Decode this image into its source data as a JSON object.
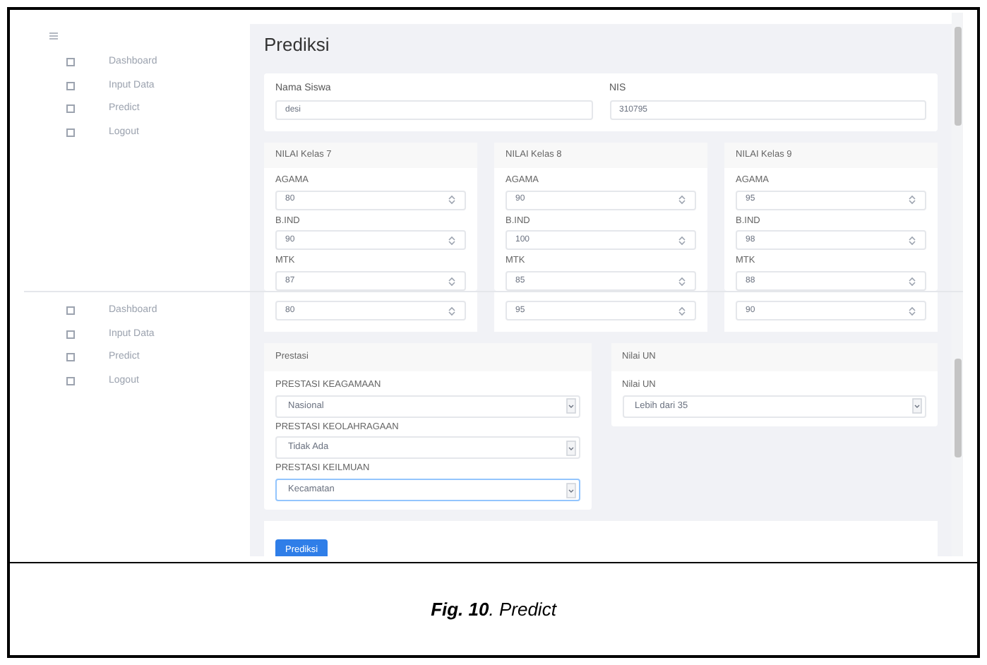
{
  "top_view": {
    "sidebar": [
      {
        "label": "Dashboard"
      },
      {
        "label": "Input Data"
      },
      {
        "label": "Predict"
      },
      {
        "label": "Logout"
      }
    ],
    "title": "Prediksi",
    "student": {
      "name_label": "Nama Siswa",
      "name_value": "desi",
      "nis_label": "NIS",
      "nis_value": "310795"
    },
    "grade_cards": [
      {
        "title": "NILAI Kelas 7",
        "fields": [
          {
            "label": "AGAMA",
            "value": "80"
          },
          {
            "label": "B.IND",
            "value": "90"
          },
          {
            "label": "MTK",
            "value": "87"
          }
        ]
      },
      {
        "title": "NILAI Kelas 8",
        "fields": [
          {
            "label": "AGAMA",
            "value": "90"
          },
          {
            "label": "B.IND",
            "value": "100"
          },
          {
            "label": "MTK",
            "value": "85"
          }
        ]
      },
      {
        "title": "NILAI Kelas 9",
        "fields": [
          {
            "label": "AGAMA",
            "value": "95"
          },
          {
            "label": "B.IND",
            "value": "98"
          },
          {
            "label": "MTK",
            "value": "88"
          }
        ]
      }
    ]
  },
  "bottom_view": {
    "sidebar": [
      {
        "label": "Dashboard"
      },
      {
        "label": "Input Data"
      },
      {
        "label": "Predict"
      },
      {
        "label": "Logout"
      }
    ],
    "grade_values": [
      "80",
      "95",
      "90"
    ],
    "prestasi": {
      "title": "Prestasi",
      "fields": [
        {
          "label": "PRESTASI KEAGAMAAN",
          "value": "Nasional",
          "focused": false
        },
        {
          "label": "PRESTASI KEOLAHRAGAAN",
          "value": "Tidak Ada",
          "focused": false
        },
        {
          "label": "PRESTASI KEILMUAN",
          "value": "Kecamatan",
          "focused": true
        }
      ]
    },
    "nilai_un": {
      "title": "Nilai UN",
      "fields": [
        {
          "label": "Nilai UN",
          "value": "Lebih dari 35",
          "focused": false
        }
      ]
    },
    "submit_label": "Prediksi"
  },
  "caption": "**Fig. 10**. Predict"
}
